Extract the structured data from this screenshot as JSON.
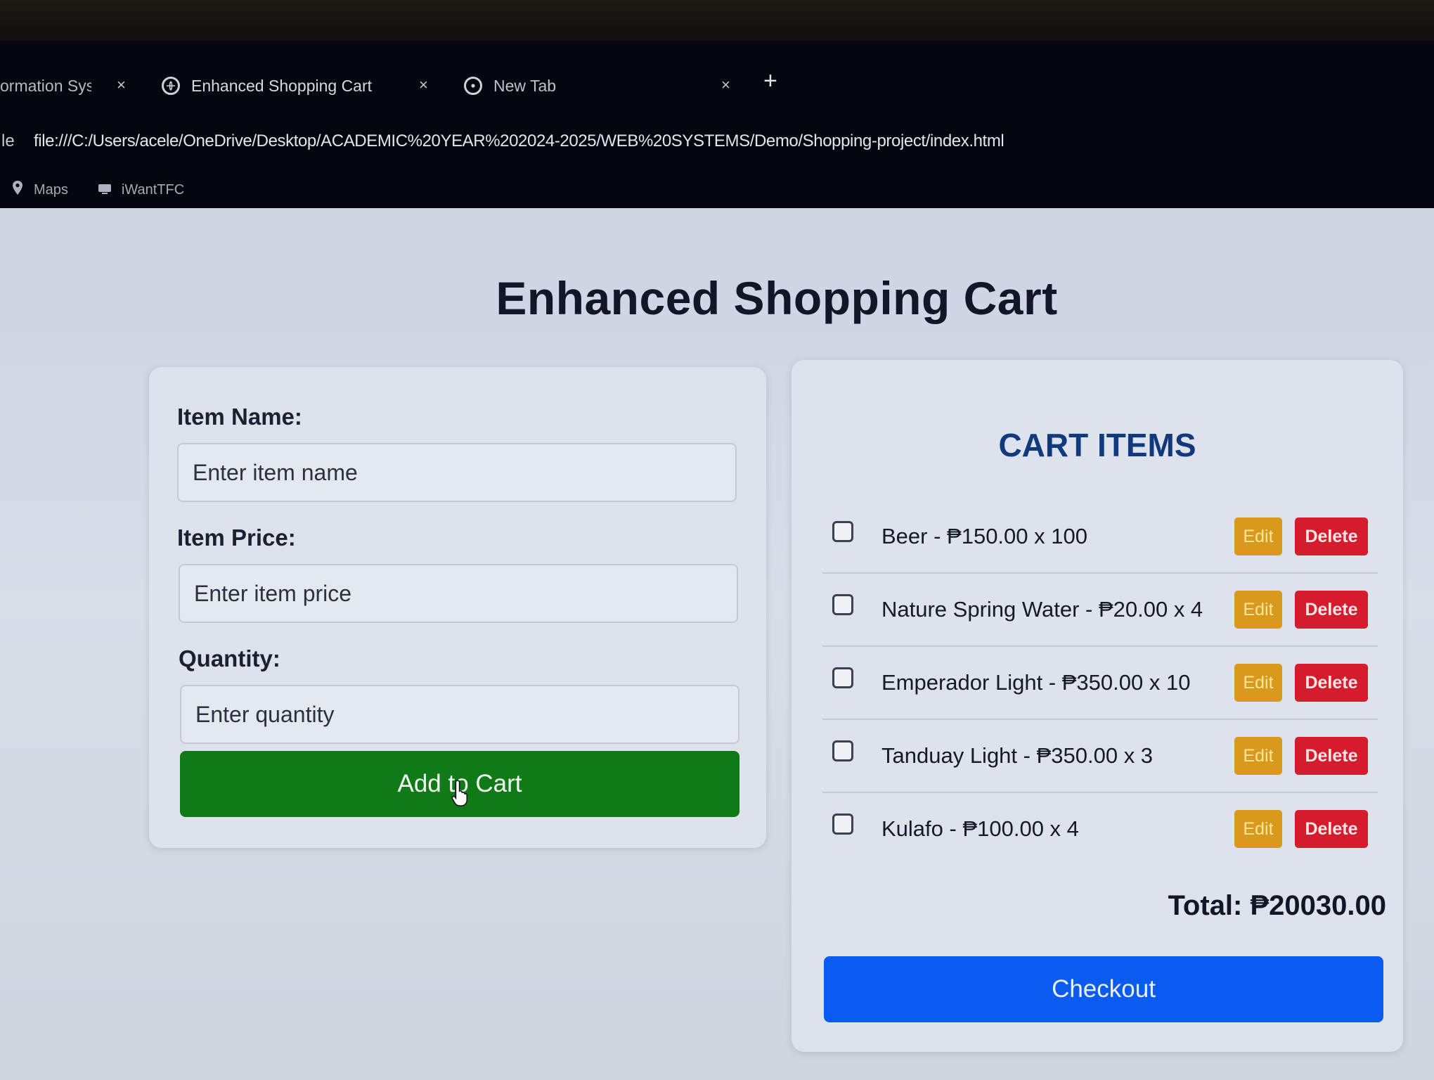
{
  "browser": {
    "tabs": [
      {
        "title": "ormation Sys",
        "close": "×",
        "active": false
      },
      {
        "title": "Enhanced Shopping Cart",
        "close": "×",
        "active": true
      },
      {
        "title": "New Tab",
        "close": "×",
        "active": false
      }
    ],
    "new_tab_label": "+",
    "address": {
      "prefix": "le",
      "url": "file:///C:/Users/acele/OneDrive/Desktop/ACADEMIC%20YEAR%202024-2025/WEB%20SYSTEMS/Demo/Shopping-project/index.html"
    },
    "bookmarks": [
      {
        "label": "Maps",
        "icon": "map-pin-icon"
      },
      {
        "label": "iWantTFC",
        "icon": "tv-icon"
      }
    ]
  },
  "page": {
    "title": "Enhanced Shopping Cart"
  },
  "form": {
    "item_name_label": "Item Name:",
    "item_name_placeholder": "Enter item name",
    "item_price_label": "Item Price:",
    "item_price_placeholder": "Enter item price",
    "quantity_label": "Quantity:",
    "quantity_placeholder": "Enter quantity",
    "add_button_label": "Add to Cart"
  },
  "cart": {
    "heading": "CART ITEMS",
    "edit_label": "Edit",
    "delete_label": "Delete",
    "items": [
      {
        "text": "Beer - ₱150.00 x 100",
        "checked": false
      },
      {
        "text": "Nature Spring Water - ₱20.00 x 4",
        "checked": false
      },
      {
        "text": "Emperador Light - ₱350.00 x 10",
        "checked": false
      },
      {
        "text": "Tanduay Light - ₱350.00 x 3",
        "checked": false
      },
      {
        "text": "Kulafo - ₱100.00 x 4",
        "checked": false
      }
    ],
    "total": "Total: ₱20030.00",
    "checkout_label": "Checkout"
  },
  "colors": {
    "add_button": "#0f7a16",
    "checkout_button": "#0a5cf0",
    "edit_button": "#d9991a",
    "delete_button": "#d51c2c",
    "heading": "#103a7c"
  }
}
